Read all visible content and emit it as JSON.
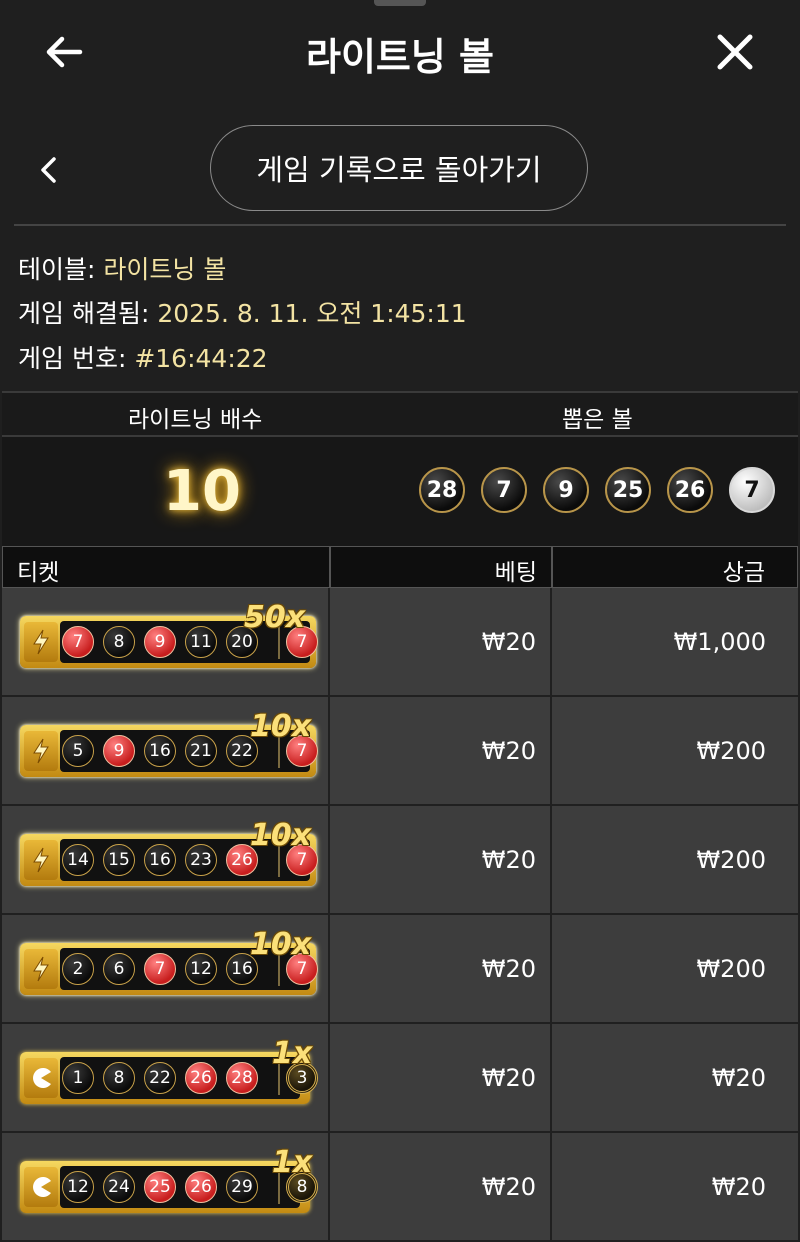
{
  "header": {
    "title": "라이트닝 볼"
  },
  "history_button": {
    "label": "게임 기록으로 돌아가기"
  },
  "info": {
    "table_label": "테이블:",
    "table_value": "라이트닝 볼",
    "resolved_label": "게임 해결됨:",
    "resolved_value": "2025. 8. 11. 오전 1:45:11",
    "number_label": "게임 번호:",
    "number_value": "#16:44:22"
  },
  "result": {
    "multiplier_header": "라이트닝 배수",
    "balls_header": "뽑은 볼",
    "multiplier": "10",
    "drawn_balls": [
      "28",
      "7",
      "9",
      "25",
      "26",
      "7"
    ]
  },
  "tickets_table": {
    "headers": {
      "ticket": "티켓",
      "bet": "베팅",
      "prize": "상금"
    },
    "rows": [
      {
        "multiplier": "50x",
        "balls": [
          "7",
          "8",
          "9",
          "11",
          "20"
        ],
        "extra": "7",
        "bet": "₩20",
        "prize": "₩1,000"
      },
      {
        "multiplier": "10x",
        "balls": [
          "5",
          "9",
          "16",
          "21",
          "22"
        ],
        "extra": "7",
        "bet": "₩20",
        "prize": "₩200"
      },
      {
        "multiplier": "10x",
        "balls": [
          "14",
          "15",
          "16",
          "23",
          "26"
        ],
        "extra": "7",
        "bet": "₩20",
        "prize": "₩200"
      },
      {
        "multiplier": "10x",
        "balls": [
          "2",
          "6",
          "7",
          "12",
          "16"
        ],
        "extra": "7",
        "bet": "₩20",
        "prize": "₩200"
      },
      {
        "multiplier": "1x",
        "balls": [
          "1",
          "8",
          "22",
          "26",
          "28"
        ],
        "extra": "3",
        "bet": "₩20",
        "prize": "₩20"
      },
      {
        "multiplier": "1x",
        "balls": [
          "12",
          "24",
          "25",
          "26",
          "29"
        ],
        "extra": "8",
        "bet": "₩20",
        "prize": "₩20"
      }
    ]
  },
  "colors": {
    "accent_gold": "#f3e3a3",
    "ball_red": "#c81e1e",
    "background": "#1f1f1f",
    "row_background": "#3d3d3d"
  },
  "icons": [
    "back-arrow-icon",
    "close-icon",
    "chevron-left-icon",
    "lightning-icon",
    "pac-icon"
  ]
}
